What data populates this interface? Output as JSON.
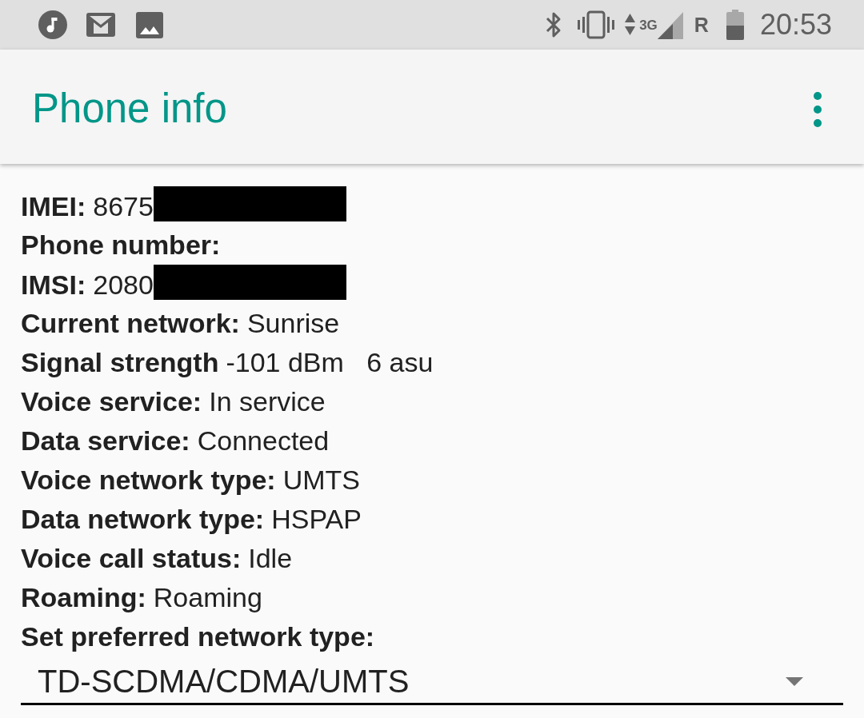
{
  "status_bar": {
    "network_label": "3G",
    "roaming_label": "R",
    "time": "20:53"
  },
  "app_bar": {
    "title": "Phone info"
  },
  "info_rows": [
    {
      "label": "IMEI:",
      "value": "8675",
      "redacted": true
    },
    {
      "label": "Phone number:",
      "redacted": false
    },
    {
      "label": "IMSI:",
      "value": "2080",
      "redacted": true
    },
    {
      "label": "Current network:",
      "value": "Sunrise",
      "redacted": false
    },
    {
      "label": "Signal strength",
      "value": "-101 dBm   6 asu",
      "redacted": false
    },
    {
      "label": "Voice service:",
      "value": "In service",
      "redacted": false
    },
    {
      "label": "Data service:",
      "value": "Connected",
      "redacted": false
    },
    {
      "label": "Voice network type:",
      "value": "UMTS",
      "redacted": false
    },
    {
      "label": "Data network type:",
      "value": "HSPAP",
      "redacted": false
    },
    {
      "label": "Voice call status:",
      "value": "Idle",
      "redacted": false
    },
    {
      "label": "Roaming:",
      "value": "Roaming",
      "redacted": false
    }
  ],
  "preferred_network": {
    "label": "Set preferred network type:",
    "selected_value": "TD-SCDMA/CDMA/UMTS"
  }
}
